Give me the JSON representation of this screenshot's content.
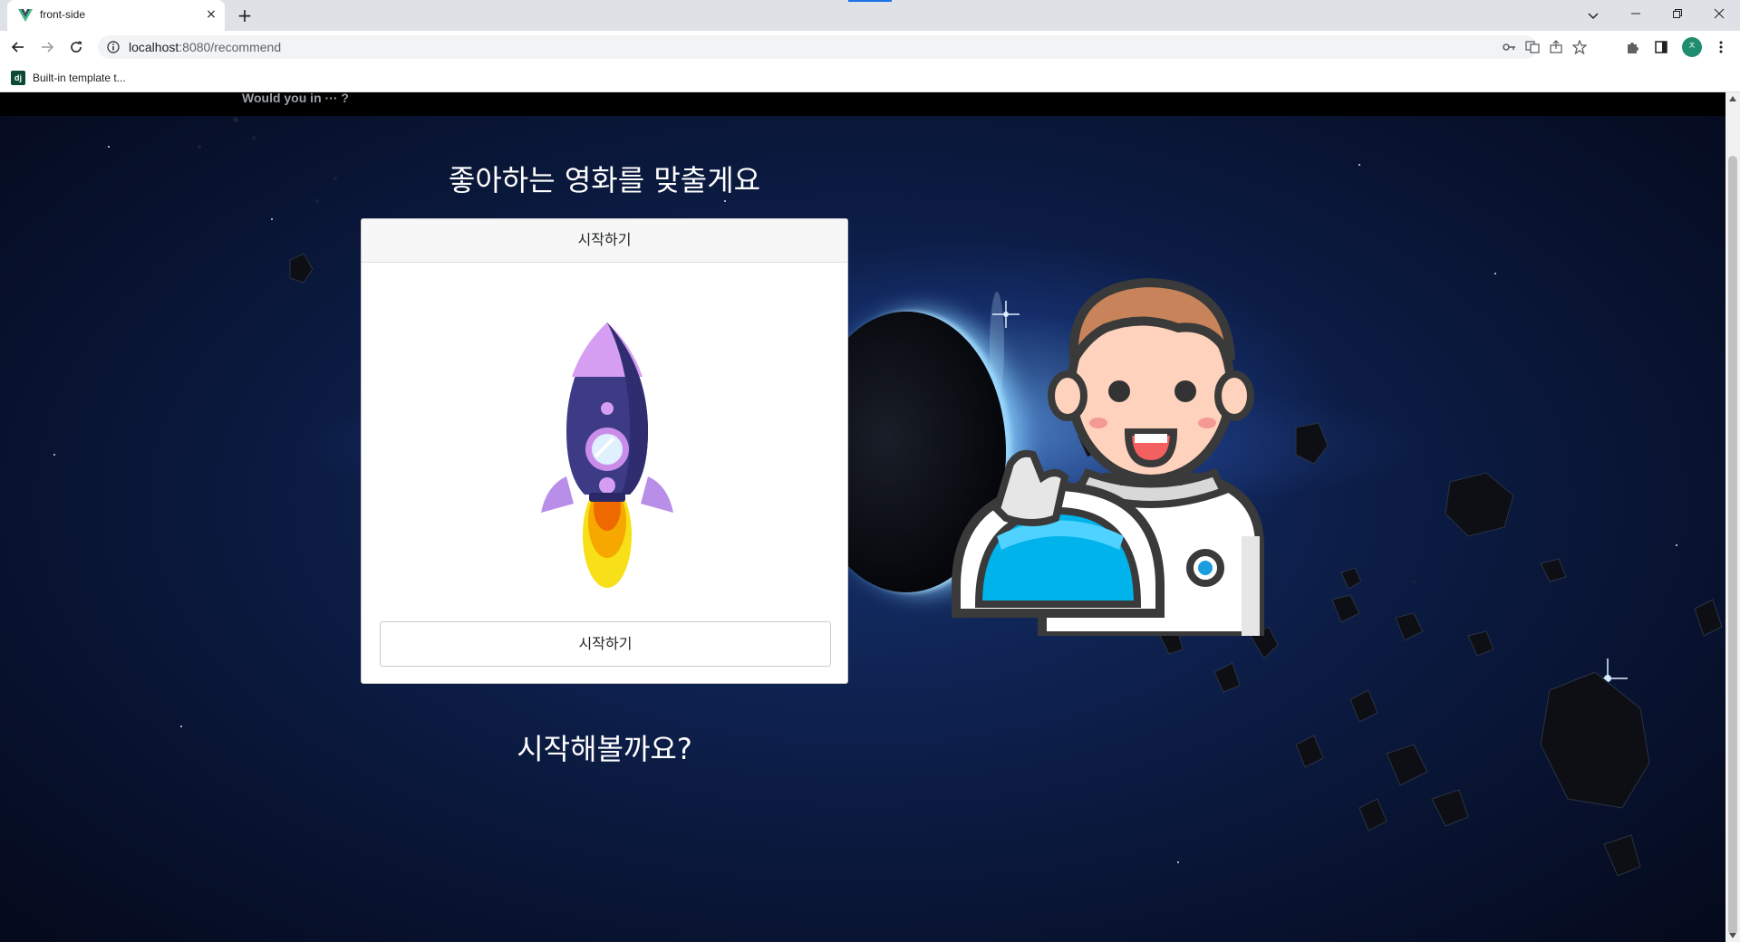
{
  "browser": {
    "tab_title": "front-side",
    "tab_close": "×",
    "new_tab": "+",
    "url_host": "localhost",
    "url_rest": ":8080/recommend",
    "profile_initial": "ㅈ",
    "bookmark_favicon": "dj",
    "bookmark_label": "Built-in template t..."
  },
  "page": {
    "nav_brand": "Would you in ··· ?",
    "headline": "좋아하는 영화를 맞출게요",
    "card_header": "시작하기",
    "start_button": "시작하기",
    "bottom_text": "시작해볼까요?"
  },
  "colors": {
    "accent": "#1a73e8",
    "page_bg": "#0b1a40"
  }
}
